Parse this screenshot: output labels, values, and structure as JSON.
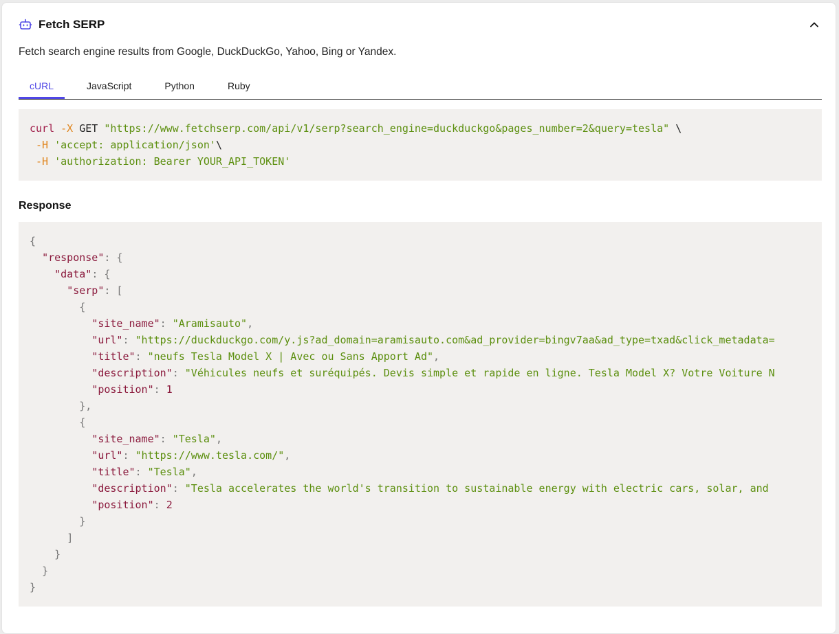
{
  "header": {
    "title": "Fetch SERP",
    "icon": "robot-icon",
    "collapse_icon": "chevron-up-icon"
  },
  "description": "Fetch search engine results from Google, DuckDuckGo, Yahoo, Bing or Yandex.",
  "tabs": [
    {
      "label": "cURL",
      "active": true
    },
    {
      "label": "JavaScript",
      "active": false
    },
    {
      "label": "Python",
      "active": false
    },
    {
      "label": "Ruby",
      "active": false
    }
  ],
  "curl": {
    "cmd": "curl",
    "flag_x": "-X",
    "method": "GET",
    "url": "\"https://www.fetchserp.com/api/v1/serp?search_engine=duckduckgo&pages_number=2&query=tesla\"",
    "cont": " \\",
    "flag_h": "-H",
    "header1": "'accept: application/json'",
    "header1_cont": "\\",
    "header2": "'authorization: Bearer YOUR_API_TOKEN'"
  },
  "response_label": "Response",
  "response": {
    "k_response": "\"response\"",
    "k_data": "\"data\"",
    "k_serp": "\"serp\"",
    "k_site_name": "\"site_name\"",
    "k_url": "\"url\"",
    "k_title": "\"title\"",
    "k_description": "\"description\"",
    "k_position": "\"position\"",
    "items": [
      {
        "site_name": "\"Aramisauto\"",
        "url": "\"https://duckduckgo.com/y.js?ad_domain=aramisauto.com&ad_provider=bingv7aa&ad_type=txad&click_metadata=",
        "title": "\"neufs Tesla Model X | Avec ou Sans Apport Ad\"",
        "description": "\"Véhicules neufs et suréquipés. Devis simple et rapide en ligne. Tesla Model X? Votre Voiture N",
        "position": "1"
      },
      {
        "site_name": "\"Tesla\"",
        "url": "\"https://www.tesla.com/\"",
        "title": "\"Tesla\"",
        "description": "\"Tesla accelerates the world's transition to sustainable energy with electric cars, solar, and",
        "position": "2"
      }
    ]
  }
}
